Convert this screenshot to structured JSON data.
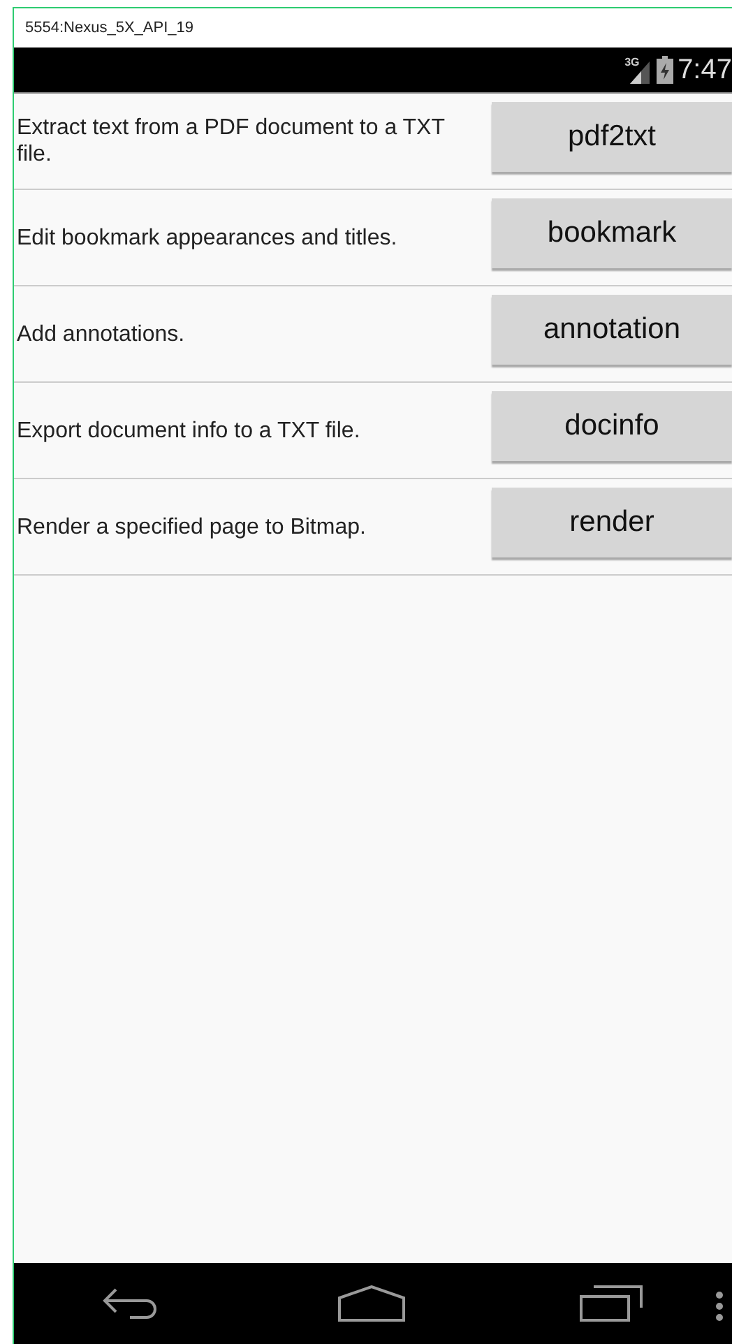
{
  "window": {
    "title": "5554:Nexus_5X_API_19"
  },
  "status_bar": {
    "network": "3G",
    "time": "7:47"
  },
  "rows": [
    {
      "description": "Extract text from a PDF document to a TXT file.",
      "button": "pdf2txt"
    },
    {
      "description": "Edit bookmark appearances and titles.",
      "button": "bookmark"
    },
    {
      "description": "Add annotations.",
      "button": "annotation"
    },
    {
      "description": "Export document info to a TXT file.",
      "button": "docinfo"
    },
    {
      "description": "Render a specified page to Bitmap.",
      "button": "render"
    }
  ]
}
